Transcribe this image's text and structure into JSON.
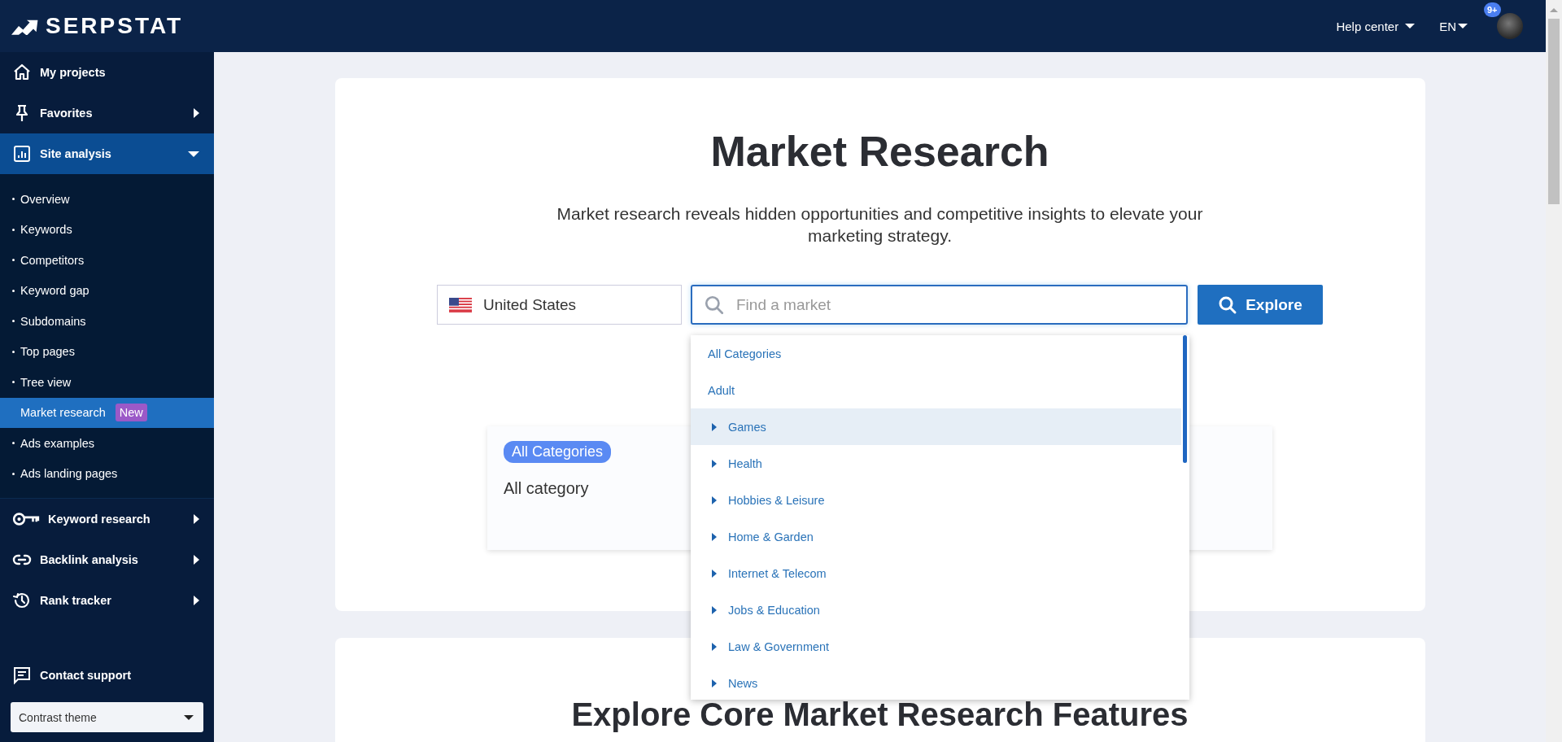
{
  "header": {
    "logo": "SERPSTAT",
    "help": "Help center",
    "language": "EN",
    "notifications": "9+"
  },
  "sidebar": {
    "items": [
      {
        "label": "My projects",
        "kind": "link",
        "selected": false
      },
      {
        "label": "Favorites",
        "kind": "menu",
        "expanded": false,
        "selected": false
      },
      {
        "label": "Site analysis",
        "kind": "menu",
        "expanded": true,
        "selected": true,
        "children": [
          {
            "label": "Overview",
            "selected": false
          },
          {
            "label": "Keywords",
            "selected": false
          },
          {
            "label": "Competitors",
            "selected": false
          },
          {
            "label": "Keyword gap",
            "selected": false
          },
          {
            "label": "Subdomains",
            "selected": false
          },
          {
            "label": "Top pages",
            "selected": false
          },
          {
            "label": "Tree view",
            "selected": false
          },
          {
            "label": "Market research",
            "selected": true,
            "badge": "New"
          },
          {
            "label": "Ads examples",
            "selected": false
          },
          {
            "label": "Ads landing pages",
            "selected": false
          }
        ]
      },
      {
        "label": "Keyword research",
        "kind": "menu",
        "expanded": false,
        "selected": false
      },
      {
        "label": "Backlink analysis",
        "kind": "menu",
        "expanded": false,
        "selected": false
      },
      {
        "label": "Rank tracker",
        "kind": "menu",
        "expanded": false,
        "selected": false
      }
    ],
    "contact": "Contact support",
    "theme_select": "Contrast theme"
  },
  "main": {
    "title": "Market Research",
    "subtitle": "Market research reveals hidden opportunities and competitive insights to elevate your marketing strategy.",
    "country_select": {
      "value": "United States"
    },
    "search": {
      "placeholder": "Find a market"
    },
    "explore_button": "Explore",
    "dropdown": {
      "items": [
        {
          "label": "All Categories",
          "kind": "leaf",
          "highlighted": false
        },
        {
          "label": "Adult",
          "kind": "leaf",
          "highlighted": false
        },
        {
          "label": "Games",
          "kind": "parent",
          "highlighted": true
        },
        {
          "label": "Health",
          "kind": "parent",
          "highlighted": false
        },
        {
          "label": "Hobbies & Leisure",
          "kind": "parent",
          "highlighted": false
        },
        {
          "label": "Home & Garden",
          "kind": "parent",
          "highlighted": false
        },
        {
          "label": "Internet & Telecom",
          "kind": "parent",
          "highlighted": false
        },
        {
          "label": "Jobs & Education",
          "kind": "parent",
          "highlighted": false
        },
        {
          "label": "Law & Government",
          "kind": "parent",
          "highlighted": false
        },
        {
          "label": "News",
          "kind": "parent",
          "highlighted": false
        }
      ]
    },
    "category_card": {
      "badge": "All Categories",
      "text": "All category"
    },
    "features_title": "Explore Core Market Research Features"
  }
}
